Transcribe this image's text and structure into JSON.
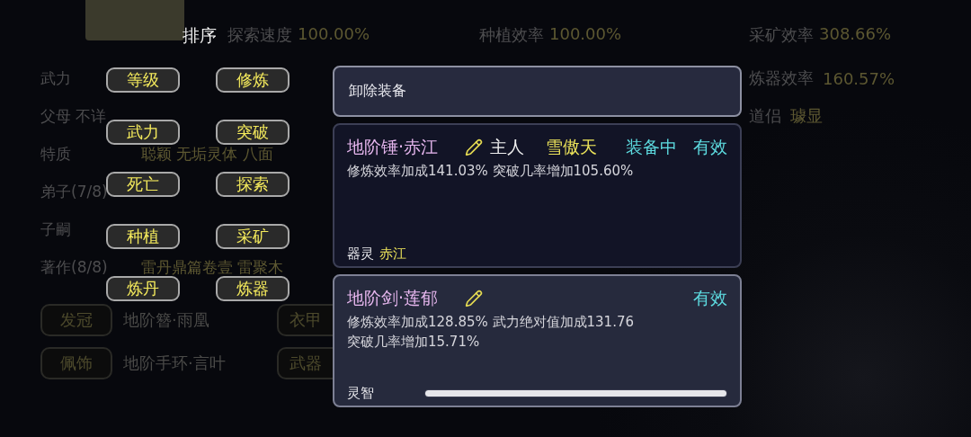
{
  "top_stats": [
    {
      "label": "探索速度",
      "value": "100.00%"
    },
    {
      "label": "种植效率",
      "value": "100.00%"
    },
    {
      "label": "采矿效率",
      "value": "308.66%"
    }
  ],
  "info_rows": [
    {
      "label": "武力"
    },
    {
      "label": "父母 不详"
    },
    {
      "label": "特质",
      "value": "聪颖 无垢灵体 八面"
    },
    {
      "label": "弟子(7/8)"
    },
    {
      "label": "子嗣"
    },
    {
      "label": "著作(8/8)",
      "value": "雷丹鼎篇卷壹 雷聚木"
    }
  ],
  "equipment_slots": [
    {
      "slot": "发冠",
      "item": "地阶簪·雨凰",
      "slot_2": "衣甲"
    },
    {
      "slot": "佩饰",
      "item": "地阶手环·言叶",
      "slot_2": "武器"
    }
  ],
  "right_stats": [
    {
      "label": "炼器效率",
      "value": "160.57%"
    },
    {
      "label": "道侣",
      "value": "璩显"
    }
  ],
  "sort_menu": {
    "title": "排序",
    "options": [
      "等级",
      "修炼",
      "武力",
      "突破",
      "死亡",
      "探索",
      "种植",
      "采矿",
      "炼丹",
      "炼器"
    ]
  },
  "equip_panel": {
    "unequip_button": "卸除装备",
    "items": [
      {
        "kind": "spirit",
        "name": "地阶锤·赤江",
        "editable": true,
        "owner_label": "主人",
        "owner": "雪傲天",
        "equipped": "装备中",
        "status": "有效",
        "effects": [
          "修炼效率加成141.03% 突破几率增加105.60%"
        ],
        "spirit_label": "器灵",
        "spirit": "赤江"
      },
      {
        "kind": "intellect",
        "name": "地阶剑·莲郁",
        "editable": true,
        "status": "有效",
        "effects": [
          "修炼效率加成128.85% 武力绝对值加成131.76",
          "突破几率增加15.71%"
        ],
        "intellect_label": "灵智",
        "level": 1
      }
    ]
  }
}
